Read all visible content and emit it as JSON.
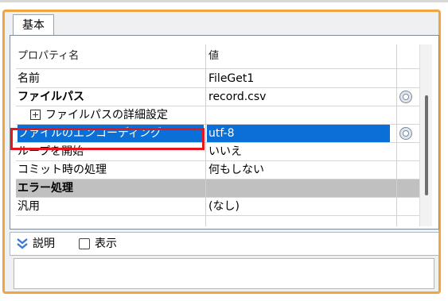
{
  "tab": {
    "label": "基本"
  },
  "grid": {
    "header": {
      "name": "プロパティ名",
      "value": "値"
    },
    "rows": [
      {
        "name": "名前",
        "value": "FileGet1"
      },
      {
        "name": "ファイルパス",
        "value": "record.csv"
      },
      {
        "name": "ファイルパスの詳細設定",
        "value": ""
      },
      {
        "name": "ファイルのエンコーディング",
        "value": "utf-8"
      },
      {
        "name": "ループを開始",
        "value": "いいえ"
      },
      {
        "name": "コミット時の処理",
        "value": "何もしない"
      },
      {
        "name": "エラー処理",
        "value": ""
      },
      {
        "name": "汎用",
        "value": "(なし)"
      }
    ]
  },
  "description": {
    "toggle_label": "説明",
    "show_label": "表示",
    "show_checked": false
  },
  "colors": {
    "selection": "#0a6fd6",
    "highlight_border": "#e8141e",
    "panel_border": "#f0a442",
    "section_bg": "#c0c0c0"
  },
  "icons": {
    "edit_button": "gear-icon",
    "expand": "expand-plus-icon",
    "collapse_description": "double-chevron-down-icon"
  }
}
